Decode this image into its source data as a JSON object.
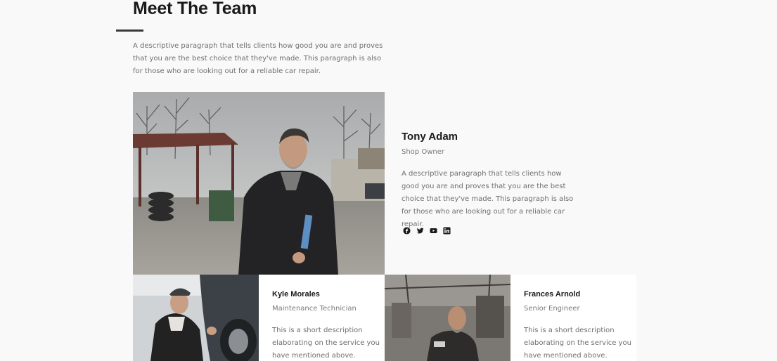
{
  "section": {
    "title": "Meet The Team",
    "intro": "A descriptive paragraph that tells clients how good you are and proves that you are the best choice that they've made. This paragraph is also for those who are looking out for a reliable car repair."
  },
  "featured": {
    "name": "Tony Adam",
    "role": "Shop Owner",
    "description": "A descriptive paragraph that tells clients how good you are and proves that you are the best choice that they've made. This paragraph is also for those who are looking out for a reliable car repair.",
    "socials": [
      "facebook-icon",
      "twitter-icon",
      "youtube-icon",
      "linkedin-icon"
    ]
  },
  "members": [
    {
      "name": "Kyle Morales",
      "role": "Maintenance Technician",
      "description": "This is a short description elaborating on the service you have mentioned above."
    },
    {
      "name": "Frances Arnold",
      "role": "Senior Engineer",
      "description": "This is a short description elaborating on the service you have mentioned above."
    }
  ],
  "colors": {
    "background": "#f9f9fa",
    "heading": "#1a1a1a",
    "body_text": "#6f6f6f",
    "card_background": "#ffffff"
  }
}
